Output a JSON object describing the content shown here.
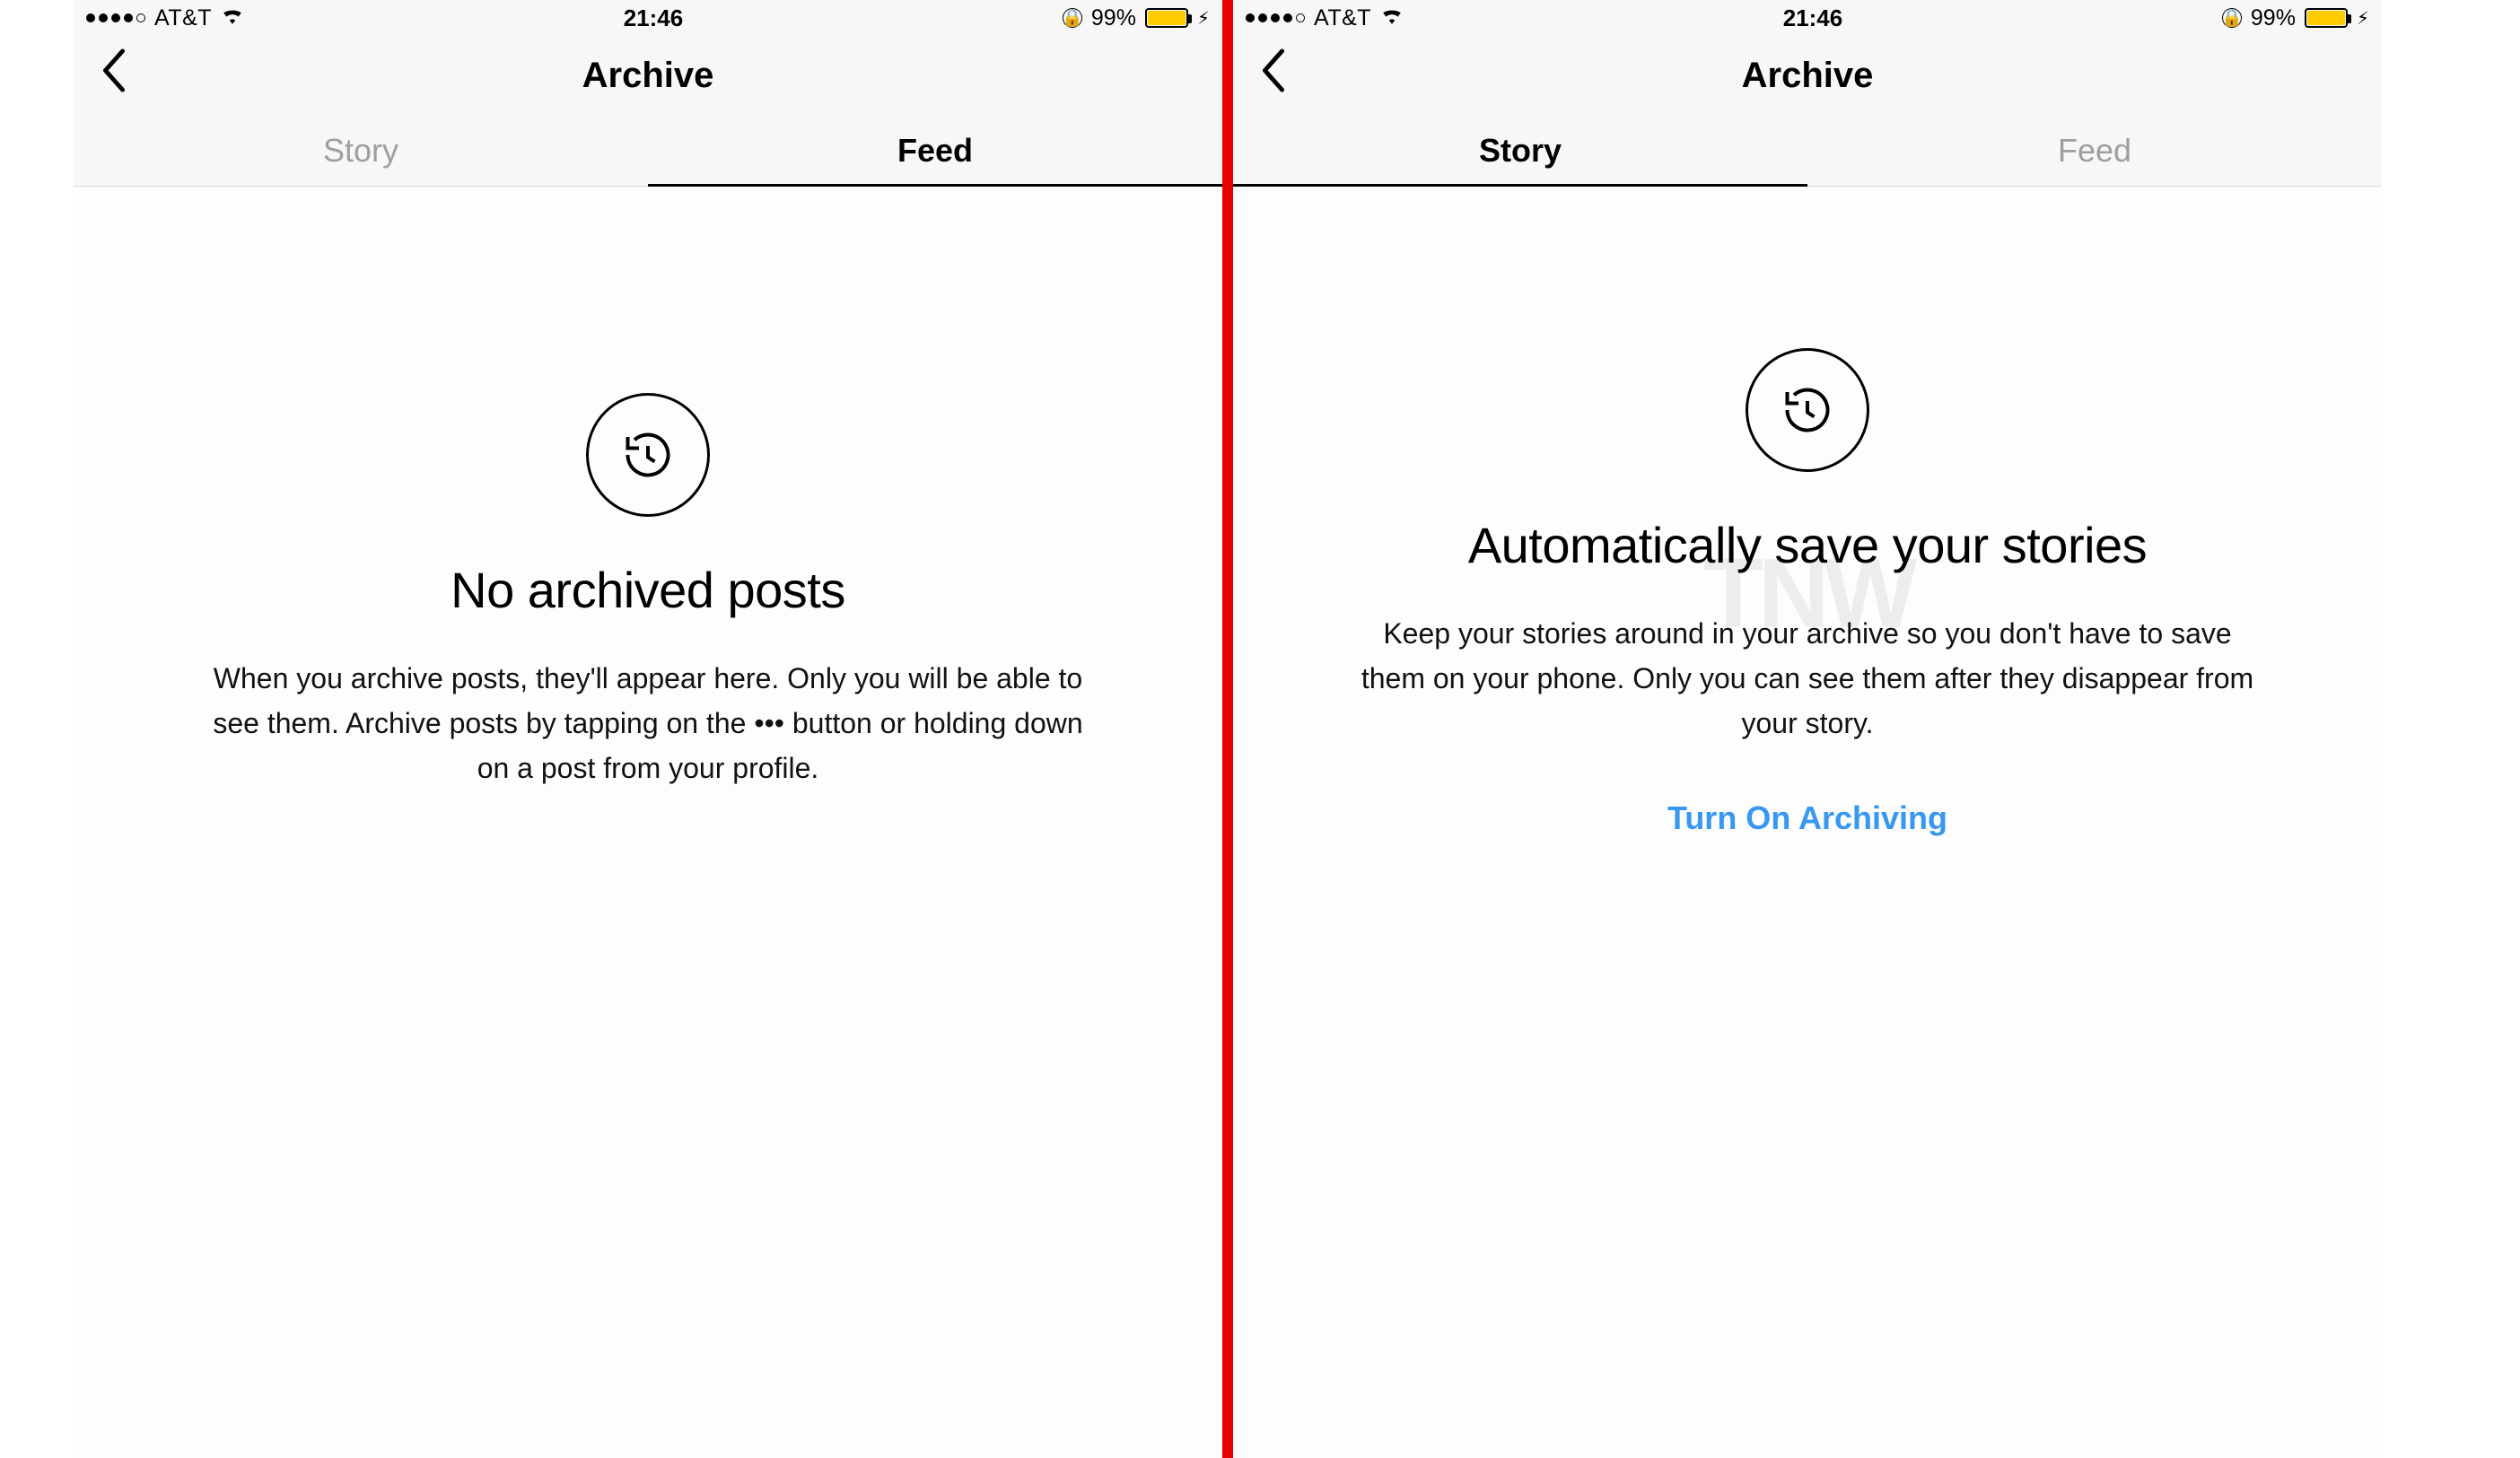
{
  "status": {
    "carrier": "AT&T",
    "time": "21:46",
    "battery_pct": "99%"
  },
  "nav": {
    "title": "Archive"
  },
  "tabs": {
    "story": "Story",
    "feed": "Feed"
  },
  "left": {
    "heading": "No archived posts",
    "body": "When you archive posts, they'll appear here. Only you will be able to see them. Archive posts by tapping on the ••• button or holding down on a post from your profile."
  },
  "right": {
    "heading": "Automatically save your stories",
    "body": "Keep your stories around in your archive so you don't have to save them on your phone. Only you can see them after they disappear from your story.",
    "cta": "Turn On Archiving"
  },
  "watermark": "TNW"
}
